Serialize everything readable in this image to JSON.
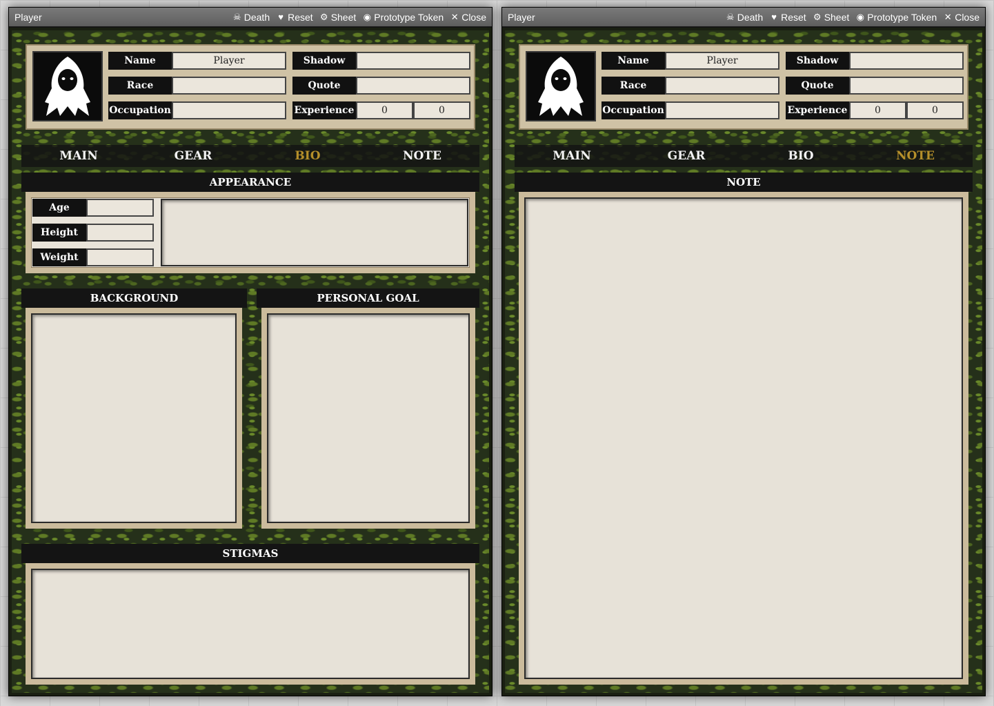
{
  "windows": [
    {
      "title": "Player",
      "controls": [
        {
          "icon": "skull-icon",
          "label": "Death"
        },
        {
          "icon": "heart-icon",
          "label": "Reset"
        },
        {
          "icon": "gear-icon",
          "label": "Sheet"
        },
        {
          "icon": "user-circle-icon",
          "label": "Prototype Token"
        },
        {
          "icon": "close-icon",
          "label": "Close"
        }
      ],
      "header": {
        "name_label": "Name",
        "name_value": "Player",
        "race_label": "Race",
        "race_value": "",
        "occupation_label": "Occupation",
        "occupation_value": "",
        "shadow_label": "Shadow",
        "shadow_value": "",
        "quote_label": "Quote",
        "quote_value": "",
        "experience_label": "Experience",
        "experience_value_1": "0",
        "experience_value_2": "0"
      },
      "tabs": [
        "MAIN",
        "GEAR",
        "BIO",
        "NOTE"
      ],
      "active_tab": "BIO",
      "bio": {
        "appearance_title": "APPEARANCE",
        "age_label": "Age",
        "height_label": "Height",
        "weight_label": "Weight",
        "background_title": "BACKGROUND",
        "personal_goal_title": "PERSONAL GOAL",
        "stigmas_title": "STIGMAS"
      }
    },
    {
      "title": "Player",
      "controls": [
        {
          "icon": "skull-icon",
          "label": "Death"
        },
        {
          "icon": "heart-icon",
          "label": "Reset"
        },
        {
          "icon": "gear-icon",
          "label": "Sheet"
        },
        {
          "icon": "user-circle-icon",
          "label": "Prototype Token"
        },
        {
          "icon": "close-icon",
          "label": "Close"
        }
      ],
      "header": {
        "name_label": "Name",
        "name_value": "Player",
        "race_label": "Race",
        "race_value": "",
        "occupation_label": "Occupation",
        "occupation_value": "",
        "shadow_label": "Shadow",
        "shadow_value": "",
        "quote_label": "Quote",
        "quote_value": "",
        "experience_label": "Experience",
        "experience_value_1": "0",
        "experience_value_2": "0"
      },
      "tabs": [
        "MAIN",
        "GEAR",
        "BIO",
        "NOTE"
      ],
      "active_tab": "NOTE",
      "note": {
        "note_title": "NOTE"
      }
    }
  ],
  "colors": {
    "active_tab": "#b58f2a",
    "titlebar": "#6a6a6a",
    "parchment": "#e9e4da",
    "frame": "#cbbb9c"
  }
}
